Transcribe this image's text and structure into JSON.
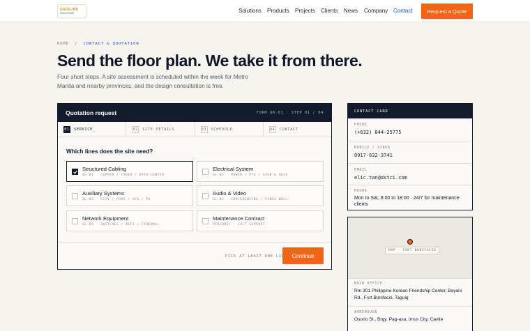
{
  "header": {
    "logo_text": "DATALINK",
    "logo_sub": "SOLUTIONS",
    "nav": [
      {
        "label": "Solutions",
        "active": false
      },
      {
        "label": "Products",
        "active": false
      },
      {
        "label": "Projects",
        "active": false
      },
      {
        "label": "Clients",
        "active": false
      },
      {
        "label": "News",
        "active": false
      },
      {
        "label": "Company",
        "active": false
      },
      {
        "label": "Contact",
        "active": true
      }
    ],
    "cta_label": "Request a Quote"
  },
  "breadcrumb": {
    "home": "HOME",
    "separator": "/",
    "current": "CONTACT & QUOTATION"
  },
  "hero": {
    "title": "Send the floor plan. We take it from there.",
    "subtitle": "Four short steps. A site assessment is scheduled within the week for Metro Manila and nearby provinces, and the design consultation is free."
  },
  "quote_form": {
    "title": "Quotation request",
    "meta": "FORM QR-01 · STEP 01 / 04",
    "steps": [
      {
        "num": "01",
        "label": "SERVICE",
        "active": true
      },
      {
        "num": "02",
        "label": "SITE DETAILS",
        "active": false
      },
      {
        "num": "03",
        "label": "SCHEDULE",
        "active": false
      },
      {
        "num": "04",
        "label": "CONTACT",
        "active": false
      }
    ],
    "question": "Which lines does the site need?",
    "options": [
      {
        "name": "Structured Cabling",
        "code": "SL-01 · COPPER / FIBER / DATA CENTER",
        "checked": true
      },
      {
        "name": "Electrical System",
        "code": "SL-02 · POWER / PTO / SIGN & SEAL",
        "checked": false
      },
      {
        "name": "Auxiliary Systems",
        "code": "SL-03 · CCTV / FDAS / ACS / PA",
        "checked": false
      },
      {
        "name": "Audio & Video",
        "code": "SL-04 · CONFERENCING / VIDEO WALL",
        "checked": false
      },
      {
        "name": "Network Equipment",
        "code": "SL-05 · SWITCHES / WIFI / FIREWALL",
        "checked": false
      },
      {
        "name": "Maintenance Contract",
        "code": "PERIODIC · 24/7 SUPPORT",
        "checked": false
      }
    ],
    "hint": "PICK AT LEAST ONE LINE",
    "continue_label": "Continue"
  },
  "contact_card": {
    "title": "CONTACT CARD",
    "rows": [
      {
        "label": "PHONE",
        "value": "(+632) 844-25775"
      },
      {
        "label": "MOBILE / VIBER",
        "value": "0917-632-3741"
      },
      {
        "label": "EMAIL",
        "value": "elic.tan@dstci.com"
      },
      {
        "label": "HOURS",
        "value": "Mon to Sat, 8:00 to 18:00 · 24/7 for maintenance clients"
      }
    ]
  },
  "offices": {
    "map_tag": "MAP · FORT BONIFACIO",
    "rows": [
      {
        "label": "MAIN OFFICE",
        "value": "Rm 301 Philippine Korean Friendship Center, Bayani Rd., Fort Bonifacio, Taguig"
      },
      {
        "label": "WAREHOUSE",
        "value": "Osorio St., Brgy. Pag-asa, Imus City, Cavite"
      }
    ]
  },
  "colors": {
    "accent": "#f26418",
    "navy": "#121a2c",
    "link_active": "#1f4fd0",
    "background": "#f6f4ef"
  }
}
